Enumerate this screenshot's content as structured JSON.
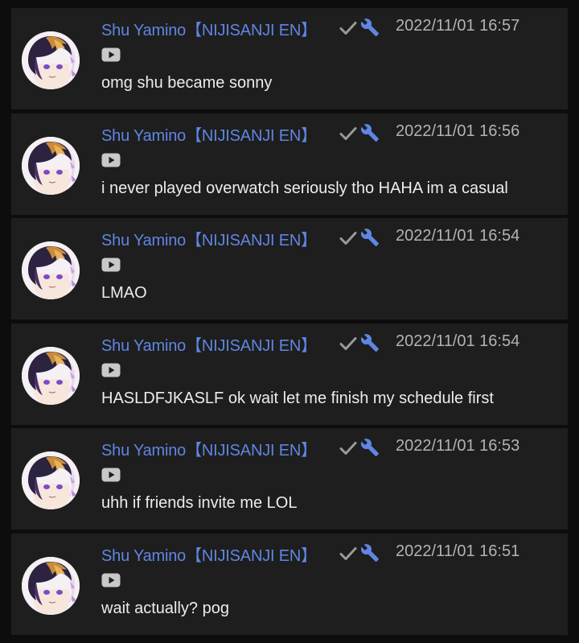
{
  "colors": {
    "page_background": "#0d0d0d",
    "card_background": "#1e1e1e",
    "author_name": "#5f86e3",
    "timestamp": "#b3b3b3",
    "message_text": "#ececec",
    "verified_check": "#9a9a9a",
    "moderator_wrench": "#5f86e3",
    "platform_icon": "#c8c8c8"
  },
  "icons": {
    "verified": "check-icon",
    "moderator": "wrench-icon",
    "platform": "youtube-icon"
  },
  "messages": [
    {
      "author": "Shu Yamino【NIJISANJI EN】",
      "time": "2022/11/01 16:57",
      "text": "omg shu became sonny"
    },
    {
      "author": "Shu Yamino【NIJISANJI EN】",
      "time": "2022/11/01 16:56",
      "text": "i never played overwatch seriously tho HAHA im a casual"
    },
    {
      "author": "Shu Yamino【NIJISANJI EN】",
      "time": "2022/11/01 16:54",
      "text": "LMAO"
    },
    {
      "author": "Shu Yamino【NIJISANJI EN】",
      "time": "2022/11/01 16:54",
      "text": "HASLDFJKASLF ok wait let me finish my schedule first"
    },
    {
      "author": "Shu Yamino【NIJISANJI EN】",
      "time": "2022/11/01 16:53",
      "text": "uhh if friends invite me LOL"
    },
    {
      "author": "Shu Yamino【NIJISANJI EN】",
      "time": "2022/11/01 16:51",
      "text": "wait actually? pog"
    }
  ]
}
